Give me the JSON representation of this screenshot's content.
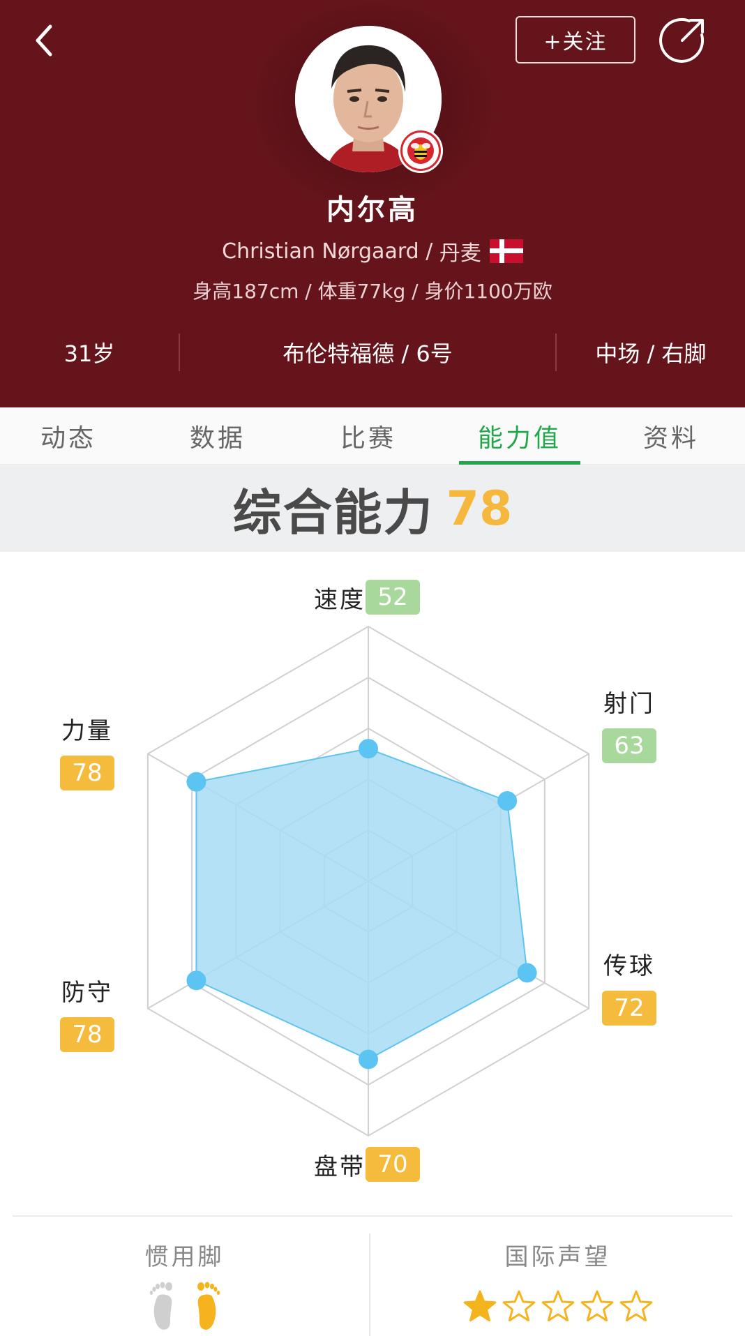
{
  "header": {
    "follow_label": "+关注",
    "name_cn": "内尔高",
    "name_en": "Christian Nørgaard",
    "nationality": "丹麦",
    "body_info": "身高187cm / 体重77kg / 身价1100万欧",
    "age": "31岁",
    "club_number": "布伦特福德 / 6号",
    "position_foot": "中场 / 右脚",
    "club_badge_text": "BRENTFORD",
    "colors": {
      "background": "#66141b",
      "flag_red": "#c8102e"
    }
  },
  "tabs": [
    {
      "label": "动态"
    },
    {
      "label": "数据"
    },
    {
      "label": "比赛"
    },
    {
      "label": "能力值",
      "active": true
    },
    {
      "label": "资料"
    }
  ],
  "overall": {
    "label": "综合能力",
    "score": "78"
  },
  "radar": {
    "max": 100,
    "attributes": [
      {
        "label": "速度",
        "value": 52,
        "display": "52",
        "color": "green"
      },
      {
        "label": "射门",
        "value": 63,
        "display": "63",
        "color": "green"
      },
      {
        "label": "传球",
        "value": 72,
        "display": "72",
        "color": "orange"
      },
      {
        "label": "盘带",
        "value": 70,
        "display": "70",
        "color": "orange"
      },
      {
        "label": "防守",
        "value": 78,
        "display": "78",
        "color": "orange"
      },
      {
        "label": "力量",
        "value": 78,
        "display": "78",
        "color": "orange"
      }
    ],
    "colors": {
      "fill": "#a8dcf6",
      "stroke": "#5ec4ee",
      "point": "#5cc4f3",
      "grid": "#d0d0d0"
    }
  },
  "bottom": {
    "preferred_foot_label": "惯用脚",
    "preferred_foot": "right",
    "reputation_label": "国际声望",
    "reputation_stars": 1,
    "reputation_max": 5
  }
}
